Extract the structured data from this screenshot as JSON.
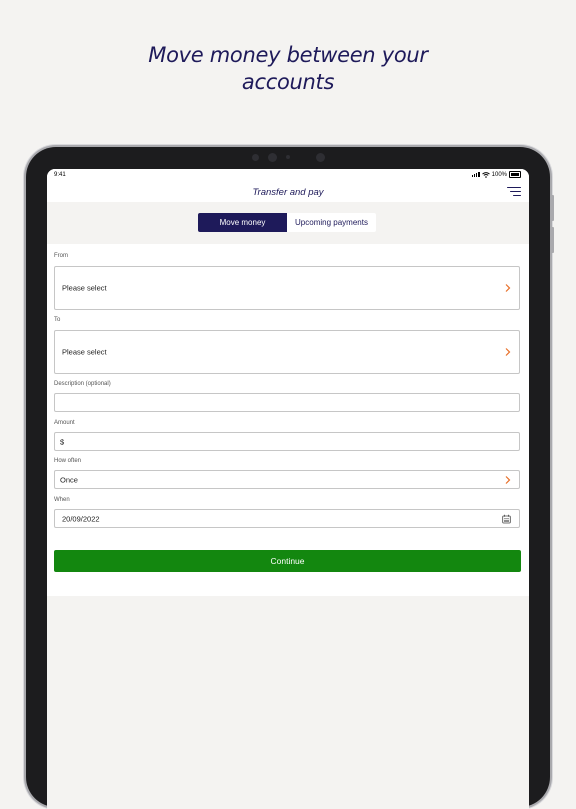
{
  "headline": {
    "line1": "Move money between your",
    "line2": "accounts"
  },
  "status_bar": {
    "time": "9:41",
    "battery": "100%"
  },
  "nav": {
    "title": "Transfer and pay",
    "menu_icon": "menu-icon"
  },
  "tabs": [
    {
      "label": "Move money",
      "active": true
    },
    {
      "label": "Upcoming payments",
      "active": false
    }
  ],
  "form": {
    "from": {
      "label": "From",
      "value": "Please select"
    },
    "to": {
      "label": "To",
      "value": "Please select"
    },
    "description": {
      "label": "Description (optional)",
      "value": ""
    },
    "amount": {
      "label": "Amount",
      "value": "$"
    },
    "how_often": {
      "label": "How often",
      "value": "Once"
    },
    "when": {
      "label": "When",
      "value": "20/09/2022"
    },
    "continue_label": "Continue"
  },
  "colors": {
    "brand": "#1e1a5a",
    "accent": "#e8702a",
    "primary_button": "#13870f"
  }
}
